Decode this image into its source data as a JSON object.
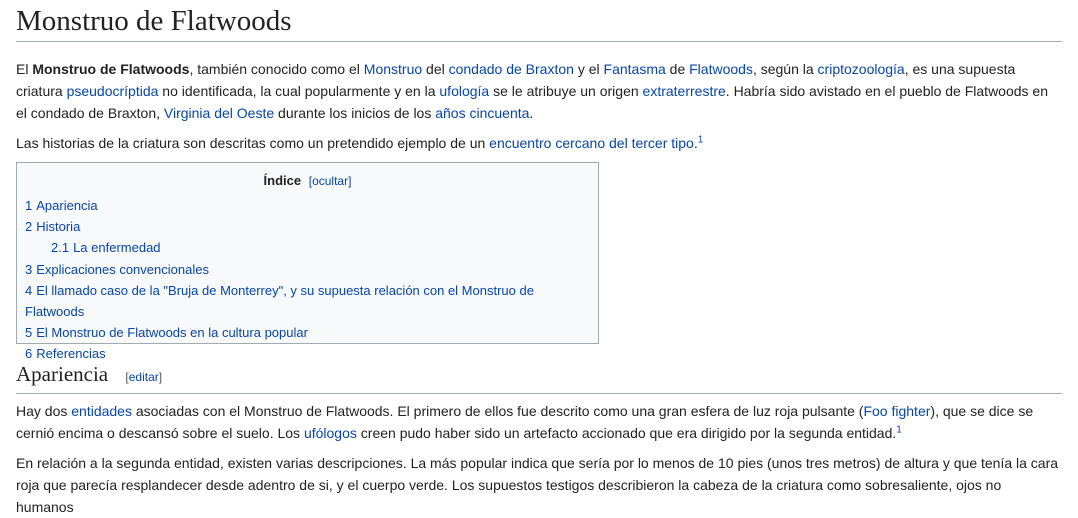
{
  "title": "Monstruo de Flatwoods",
  "intro": {
    "p1": [
      {
        "t": "El "
      },
      {
        "b": "Monstruo de Flatwoods"
      },
      {
        "t": ", también conocido como el "
      },
      {
        "a": "Monstruo"
      },
      {
        "t": " del "
      },
      {
        "a": "condado de Braxton"
      },
      {
        "t": " y el "
      },
      {
        "a": "Fantasma"
      },
      {
        "t": " de "
      },
      {
        "a": "Flatwoods"
      },
      {
        "t": ", según la "
      },
      {
        "a": "criptozoología"
      },
      {
        "t": ", es una supuesta criatura "
      },
      {
        "a": "pseudocríptida"
      },
      {
        "t": " no identificada, la cual popularmente y en la "
      },
      {
        "a": "ufología"
      },
      {
        "t": " se le atribuye un origen "
      },
      {
        "a": "extraterrestre"
      },
      {
        "t": ". Habría sido avistado en el pueblo de Flatwoods en el condado de Braxton, "
      },
      {
        "a": "Virginia del Oeste"
      },
      {
        "t": " durante los inicios de los "
      },
      {
        "a": "años cincuenta"
      },
      {
        "t": "."
      }
    ],
    "p2": [
      {
        "t": "Las historias de la criatura son descritas como un pretendido ejemplo de un "
      },
      {
        "a": "encuentro cercano del tercer tipo"
      },
      {
        "t": "."
      },
      {
        "sup": "1"
      }
    ]
  },
  "toc": {
    "title": "Índice",
    "toggle": "[ocultar]",
    "items": [
      {
        "num": "1",
        "label": "Apariencia",
        "level": 1
      },
      {
        "num": "2",
        "label": "Historia",
        "level": 1
      },
      {
        "num": "2.1",
        "label": "La enfermedad",
        "level": 2
      },
      {
        "num": "3",
        "label": "Explicaciones convencionales",
        "level": 1
      },
      {
        "num": "4",
        "label": "El llamado caso de la \"Bruja de Monterrey\", y su supuesta relación con el Monstruo de Flatwoods",
        "level": 1
      },
      {
        "num": "5",
        "label": "El Monstruo de Flatwoods en la cultura popular",
        "level": 1
      },
      {
        "num": "6",
        "label": "Referencias",
        "level": 1
      }
    ]
  },
  "section": {
    "heading": "Apariencia",
    "edit_open": "[",
    "edit_label": "editar",
    "edit_close": "]",
    "p1": [
      {
        "t": "Hay dos "
      },
      {
        "a": "entidades"
      },
      {
        "t": " asociadas con el Monstruo de Flatwoods. El primero de ellos fue descrito como una gran esfera de luz roja pulsante ("
      },
      {
        "a": "Foo fighter"
      },
      {
        "t": "), que se dice se cernió encima o descansó sobre el suelo. Los "
      },
      {
        "a": "ufólogos"
      },
      {
        "t": " creen pudo haber sido un artefacto accionado que era dirigido por la segunda entidad."
      },
      {
        "sup": "1"
      }
    ],
    "p2": [
      {
        "t": "En relación a la segunda entidad, existen varias descripciones. La más popular indica que sería por lo menos de 10 pies (unos tres metros) de altura y que tenía la cara roja que parecía resplandecer desde adentro de si, y el cuerpo verde. Los supuestos testigos describieron la cabeza de la criatura como sobresaliente, ojos no humanos"
      }
    ]
  }
}
